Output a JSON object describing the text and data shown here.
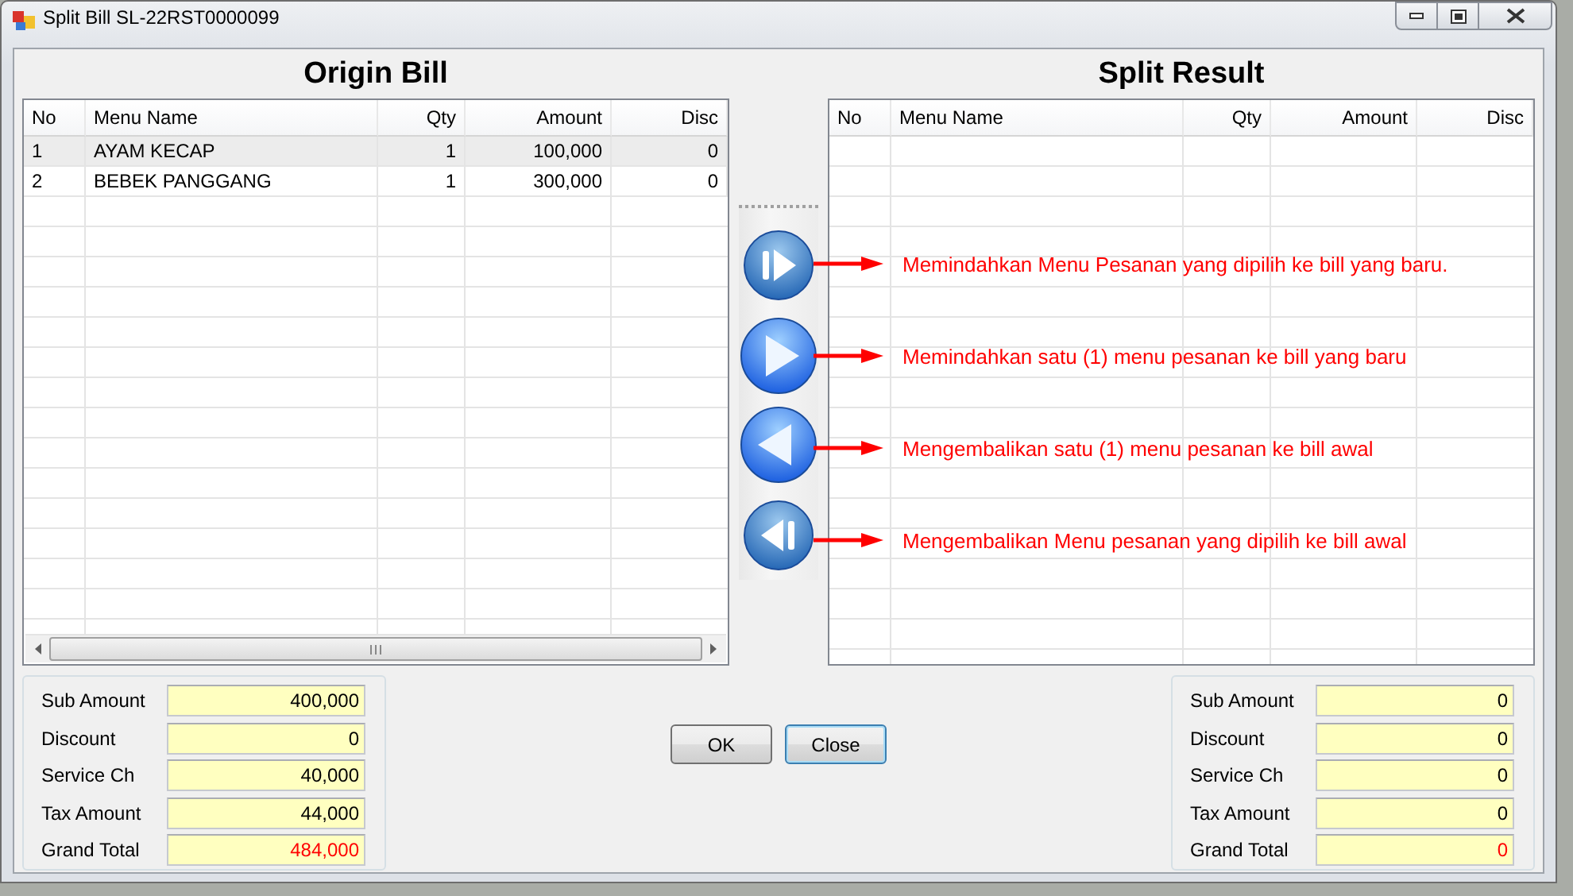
{
  "window": {
    "title": "Split Bill SL-22RST0000099"
  },
  "origin": {
    "title": "Origin Bill",
    "columns": [
      {
        "label": "No"
      },
      {
        "label": "Menu Name"
      },
      {
        "label": "Qty"
      },
      {
        "label": "Amount"
      },
      {
        "label": "Disc"
      }
    ],
    "rows": [
      {
        "cells": [
          "1",
          "AYAM KECAP",
          "1",
          "100,000",
          "0"
        ],
        "selected": true
      },
      {
        "cells": [
          "2",
          "BEBEK PANGGANG",
          "1",
          "300,000",
          "0"
        ],
        "selected": false
      }
    ]
  },
  "move_buttons": [
    {
      "kind": "move-selected",
      "note": "Memindahkan Menu Pesanan yang dipilih ke bill yang baru."
    },
    {
      "kind": "move-one",
      "note": "Memindahkan satu (1) menu pesanan ke bill yang baru"
    },
    {
      "kind": "return-one",
      "note": "Mengembalikan satu (1) menu pesanan ke bill awal"
    },
    {
      "kind": "return-selected",
      "note": "Mengembalikan Menu pesanan yang dipilih ke bill awal"
    }
  ],
  "result": {
    "title": "Split Result",
    "columns": [
      {
        "label": "No"
      },
      {
        "label": "Menu Name"
      },
      {
        "label": "Qty"
      },
      {
        "label": "Amount"
      },
      {
        "label": "Disc"
      }
    ]
  },
  "origin_totals": [
    {
      "label": "Sub Amount",
      "value": "400,000",
      "emphasis": false
    },
    {
      "label": "Discount",
      "value": "0",
      "emphasis": false
    },
    {
      "label": "Service Ch",
      "value": "40,000",
      "emphasis": false
    },
    {
      "label": "Tax Amount",
      "value": "44,000",
      "emphasis": false
    },
    {
      "label": "Grand Total",
      "value": "484,000",
      "emphasis": true
    }
  ],
  "buttons": [
    {
      "label": "OK",
      "focused": false
    },
    {
      "label": "Close",
      "focused": true
    }
  ],
  "result_totals": [
    {
      "label": "Sub Amount",
      "value": "0",
      "emphasis": false
    },
    {
      "label": "Discount",
      "value": "0",
      "emphasis": false
    },
    {
      "label": "Service Ch",
      "value": "0",
      "emphasis": false
    },
    {
      "label": "Tax Amount",
      "value": "0",
      "emphasis": false
    },
    {
      "label": "Grand Total",
      "value": "0",
      "emphasis": true
    }
  ]
}
